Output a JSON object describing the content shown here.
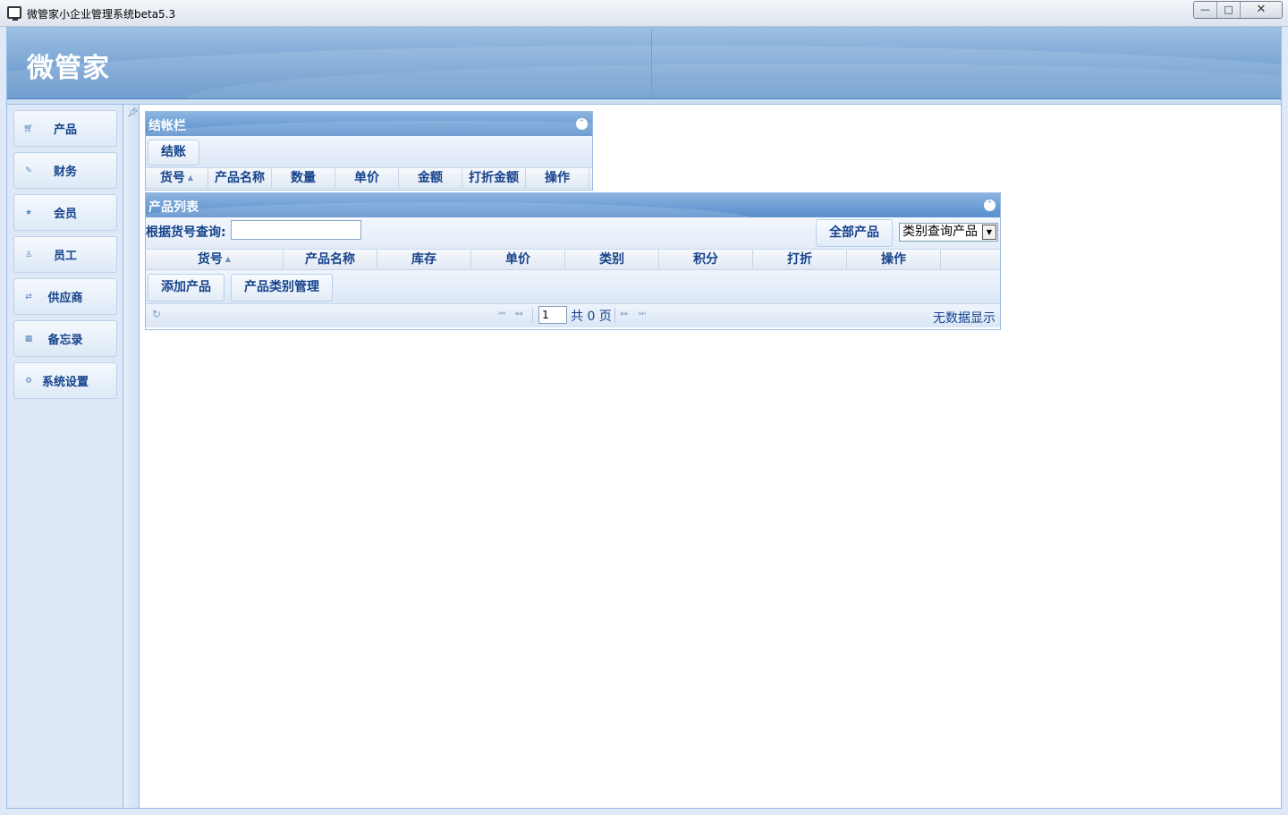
{
  "window": {
    "title": "微管家小企业管理系统beta5.3",
    "minimize": "—",
    "maximize": "□",
    "close": "✕"
  },
  "header": {
    "brand": "微管家"
  },
  "nav": {
    "items": [
      {
        "label": "产品",
        "icon": "cart-icon"
      },
      {
        "label": "财务",
        "icon": "pencil-icon"
      },
      {
        "label": "会员",
        "icon": "star-icon"
      },
      {
        "label": "员工",
        "icon": "user-icon"
      },
      {
        "label": "供应商",
        "icon": "exchange-icon"
      },
      {
        "label": "备忘录",
        "icon": "calendar-icon"
      },
      {
        "label": "系统设置",
        "icon": "gear-icon"
      }
    ]
  },
  "checkout": {
    "title": "结帐栏",
    "checkout_button": "结账",
    "columns": [
      "货号",
      "产品名称",
      "数量",
      "单价",
      "金额",
      "打折金额",
      "操作"
    ]
  },
  "products": {
    "title": "产品列表",
    "query_label": "根据货号查询:",
    "query_value": "",
    "all_products_button": "全部产品",
    "category_select": "类别查询产品",
    "columns": [
      "货号",
      "产品名称",
      "库存",
      "单价",
      "类别",
      "积分",
      "打折",
      "操作"
    ],
    "add_product_button": "添加产品",
    "category_manage_button": "产品类别管理",
    "pager": {
      "page": "1",
      "total": "共 0 页",
      "no_data": "无数据显示"
    }
  }
}
